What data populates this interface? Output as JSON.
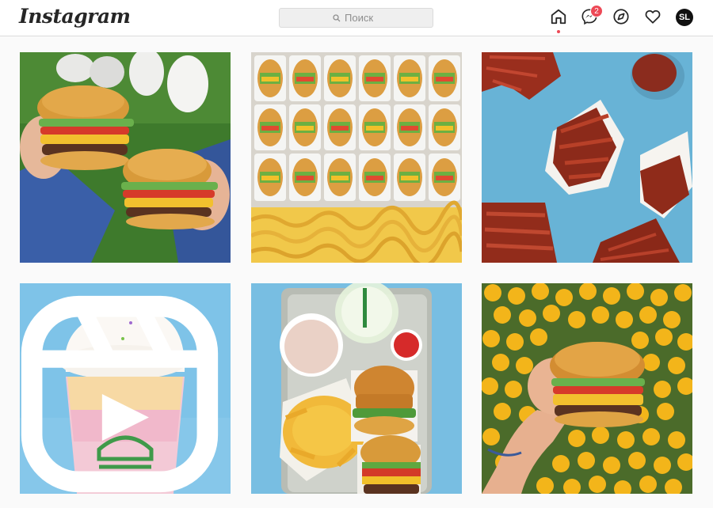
{
  "header": {
    "logo": "Instagram",
    "search_placeholder": "Поиск",
    "messages_badge": "2",
    "avatar_initials": "SL"
  },
  "icons": {
    "home": "home-icon",
    "messages": "messenger-icon",
    "explore": "compass-icon",
    "activity": "heart-icon",
    "reel": "reel-icon"
  },
  "colors": {
    "notification": "#ed4956",
    "text": "#262626",
    "border": "#dbdbdb"
  },
  "posts": [
    {
      "subject": "two-burgers-grass"
    },
    {
      "subject": "burgers-and-fries-tray"
    },
    {
      "subject": "bacon-blue-background"
    },
    {
      "subject": "milkshake-sprinkles",
      "is_reel": true
    },
    {
      "subject": "tray-cheese-fries-burgers"
    },
    {
      "subject": "burger-yellow-flowers"
    }
  ]
}
